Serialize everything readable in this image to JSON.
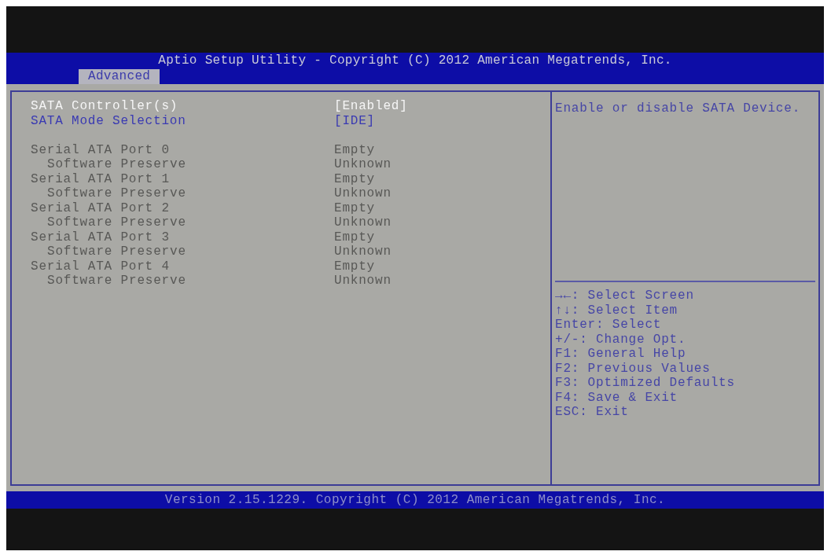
{
  "header": {
    "title": "Aptio Setup Utility - Copyright (C) 2012 American Megatrends, Inc.",
    "tabs": [
      {
        "label": "Advanced",
        "selected": true
      }
    ]
  },
  "options": [
    {
      "label": "SATA Controller(s)",
      "value": "[Enabled]",
      "selected": true
    },
    {
      "label": "SATA Mode Selection",
      "value": "[IDE]",
      "selected": false
    }
  ],
  "ports": [
    {
      "label": "Serial ATA Port 0",
      "value": "Empty",
      "children": [
        {
          "label": "Software Preserve",
          "value": "Unknown"
        }
      ]
    },
    {
      "label": "Serial ATA Port 1",
      "value": "Empty",
      "children": [
        {
          "label": "Software Preserve",
          "value": "Unknown"
        }
      ]
    },
    {
      "label": "Serial ATA Port 2",
      "value": "Empty",
      "children": [
        {
          "label": "Software Preserve",
          "value": "Unknown"
        }
      ]
    },
    {
      "label": "Serial ATA Port 3",
      "value": "Empty",
      "children": [
        {
          "label": "Software Preserve",
          "value": "Unknown"
        }
      ]
    },
    {
      "label": "Serial ATA Port 4",
      "value": "Empty",
      "children": [
        {
          "label": "Software Preserve",
          "value": "Unknown"
        }
      ]
    }
  ],
  "help_text": "Enable or disable SATA Device.",
  "key_legend": [
    "→←: Select Screen",
    "↑↓: Select Item",
    "Enter: Select",
    "+/-: Change Opt.",
    "F1: General Help",
    "F2: Previous Values",
    "F3: Optimized Defaults",
    "F4: Save & Exit",
    "ESC: Exit"
  ],
  "footer": "Version 2.15.1229. Copyright (C) 2012 American Megatrends, Inc."
}
